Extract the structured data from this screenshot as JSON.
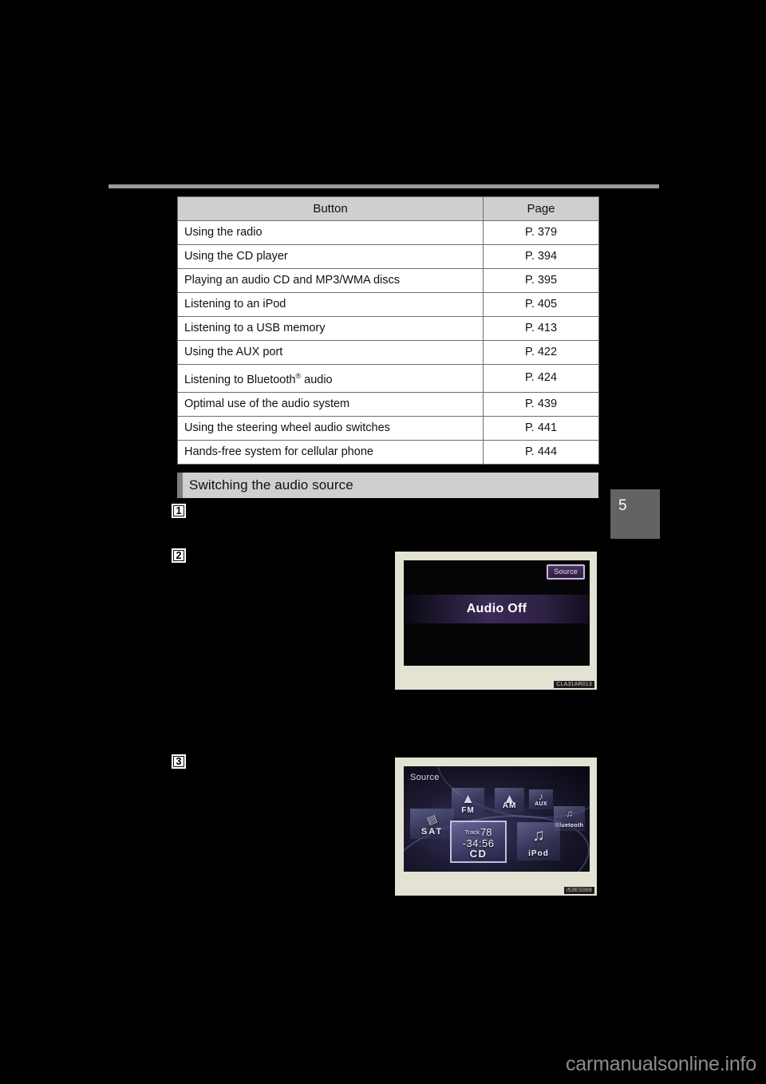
{
  "page": {
    "chapter_tab": "5",
    "watermark": "carmanualsonline.info"
  },
  "reference_table": {
    "headers": [
      "Button",
      "Page"
    ],
    "rows": [
      {
        "button": "Using the radio",
        "page": "P. 379"
      },
      {
        "button": "Using the CD player",
        "page": "P. 394"
      },
      {
        "button": "Playing an audio CD and MP3/WMA discs",
        "page": "P. 395"
      },
      {
        "button": "Listening to an iPod",
        "page": "P. 405"
      },
      {
        "button": "Listening to a USB memory",
        "page": "P. 413"
      },
      {
        "button": "Using the AUX port",
        "page": "P. 422"
      },
      {
        "button": "Listening to Bluetooth",
        "button_suffix": " audio",
        "superscript": "®",
        "page": "P. 424"
      },
      {
        "button": "Optimal use of the audio system",
        "page": "P. 439"
      },
      {
        "button": "Using the steering wheel audio switches",
        "page": "P. 441"
      },
      {
        "button": "Hands-free system for cellular phone",
        "page": "P. 444"
      }
    ]
  },
  "section": {
    "heading": "Switching the audio source",
    "steps": [
      "1",
      "2",
      "3"
    ]
  },
  "figures": [
    {
      "code": "CLA31AR013",
      "screen": {
        "source_button": "Source",
        "status_text": "Audio Off"
      }
    },
    {
      "code": "i53ES068",
      "screen": {
        "title": "Source",
        "tiles": [
          {
            "name": "FM",
            "icon": "radio-tower-icon"
          },
          {
            "name": "AM",
            "icon": "radio-tower-icon"
          },
          {
            "name": "AUX",
            "icon": "music-note-icon"
          },
          {
            "name": "Bluetooth",
            "icon": "music-note-icon"
          },
          {
            "name": "SAT",
            "icon": "satellite-radio-icon"
          },
          {
            "name": "iPod",
            "icon": "music-note-icon"
          }
        ],
        "selected_tile": {
          "track_label": "Track",
          "track_number": "78",
          "elapsed": "-34:56",
          "name": "CD"
        }
      }
    }
  ]
}
